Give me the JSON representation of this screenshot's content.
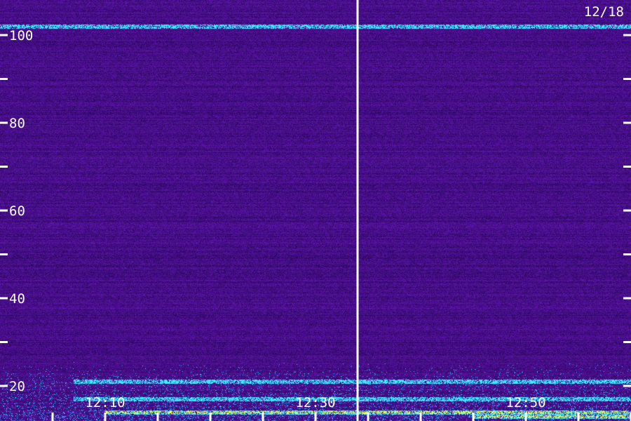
{
  "date_label": "12/18",
  "colors": {
    "background": "#2a0a5c",
    "tick": "#ffffff",
    "label": "#ffffff",
    "divider": "#ffffff",
    "intense": "#f0ff40",
    "mid": "#40e0ff"
  },
  "chart_data": {
    "type": "heatmap",
    "title": "",
    "xlabel": "",
    "ylabel": "",
    "x_range": [
      "12:00",
      "13:00"
    ],
    "ylim": [
      12,
      108
    ],
    "y_major_ticks": [
      20,
      40,
      60,
      80,
      100
    ],
    "y_minor_ticks": [
      30,
      50,
      70,
      90
    ],
    "y_tick_labels": [
      "20",
      "40",
      "60",
      "80",
      "100"
    ],
    "x_tick_labels": [
      "12:10",
      "12:30",
      "12:50"
    ],
    "x_labeled_tick_minutes": [
      10,
      30,
      50
    ],
    "x_minor_tick_minutes": [
      5,
      15,
      20,
      25,
      35,
      40,
      45,
      55,
      60
    ],
    "divider_minute": 34,
    "bands": [
      {
        "y": 102,
        "intensity": "mid",
        "span": [
          "12:00",
          "13:00"
        ]
      },
      {
        "y": 21,
        "intensity": "mid",
        "span": [
          "12:07",
          "13:00"
        ]
      },
      {
        "y": 17,
        "intensity": "mid",
        "span": [
          "12:07",
          "13:00"
        ]
      },
      {
        "y": 14,
        "intensity": "high",
        "span": [
          "12:10",
          "13:00"
        ]
      },
      {
        "y": 13,
        "intensity": "high",
        "span": [
          "12:45",
          "13:00"
        ]
      }
    ],
    "grid": false
  }
}
